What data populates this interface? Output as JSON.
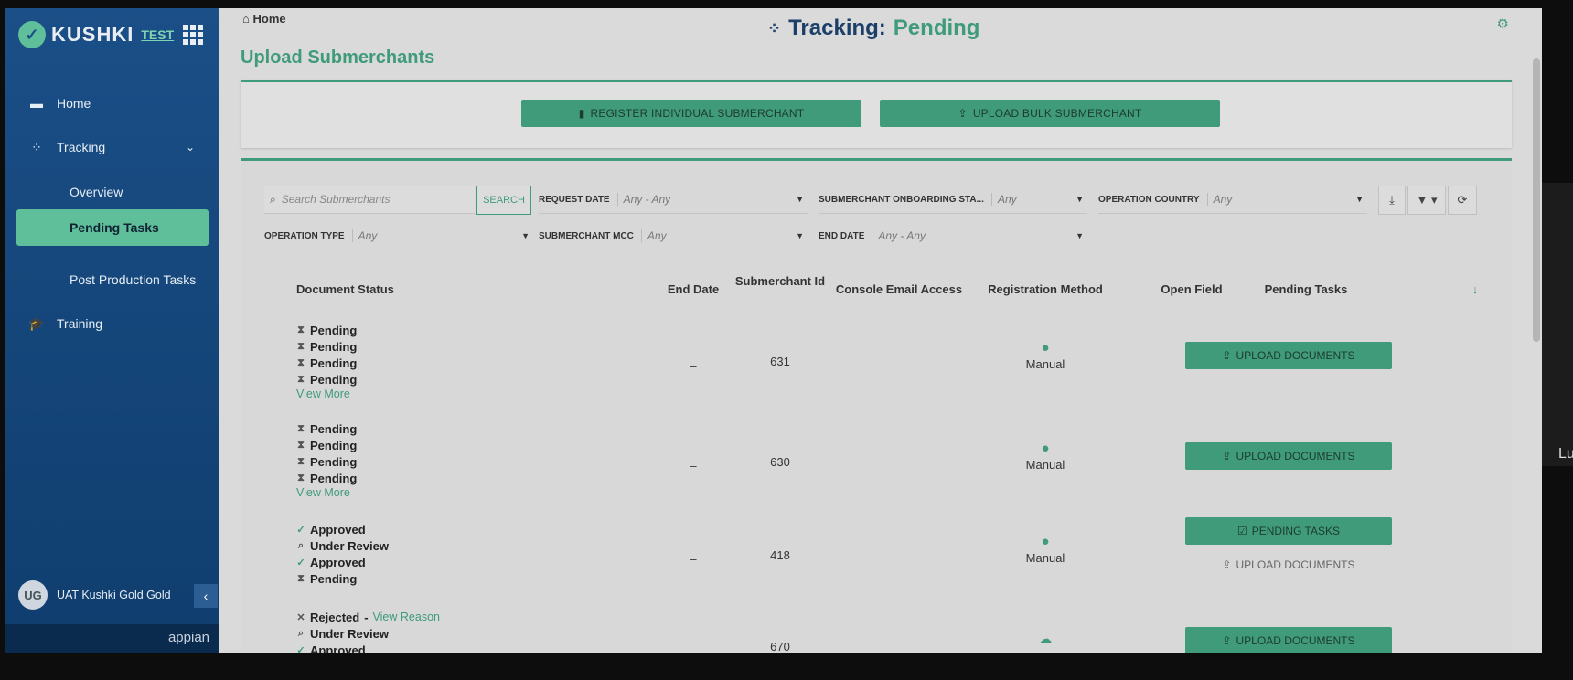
{
  "sidebar": {
    "brand": "KUSHKI",
    "env": "TEST",
    "items": [
      {
        "label": "Home",
        "icon": "home-icon"
      },
      {
        "label": "Tracking",
        "icon": "tracking-spinner-icon"
      },
      {
        "label": "Overview"
      },
      {
        "label": "Pending Tasks"
      },
      {
        "label": "Post Production Tasks"
      },
      {
        "label": "Training",
        "icon": "graduation-cap-icon"
      }
    ],
    "user_initials": "UG",
    "user_name": "UAT Kushki Gold Gold",
    "footer_brand": "appian"
  },
  "header": {
    "breadcrumb": "Home",
    "title_prefix": "Tracking:",
    "title_status": "Pending"
  },
  "page_title": "Upload Submerchants",
  "actions": {
    "register": "REGISTER INDIVIDUAL SUBMERCHANT",
    "upload_bulk": "UPLOAD BULK SUBMERCHANT"
  },
  "filters": {
    "search_placeholder": "Search Submerchants",
    "search_button": "SEARCH",
    "request_date_label": "REQUEST DATE",
    "request_date_value": "Any - Any",
    "onboarding_label": "SUBMERCHANT ONBOARDING STA...",
    "onboarding_value": "Any",
    "country_label": "OPERATION COUNTRY",
    "country_value": "Any",
    "operation_type_label": "OPERATION TYPE",
    "operation_type_value": "Any",
    "mcc_label": "SUBMERCHANT MCC",
    "mcc_value": "Any",
    "end_date_label": "END DATE",
    "end_date_value": "Any - Any"
  },
  "table": {
    "headers": {
      "document_status": "Document Status",
      "end_date": "End Date",
      "submerchant_id": "Submerchant Id",
      "console_email": "Console Email Access",
      "registration": "Registration Method",
      "open_field": "Open Field",
      "pending_tasks": "Pending Tasks"
    },
    "view_more": "View More",
    "view_reason": "View Reason",
    "rows": [
      {
        "statuses": [
          "Pending",
          "Pending",
          "Pending",
          "Pending"
        ],
        "end_date": "–",
        "id": "631",
        "method": "Manual",
        "task": "UPLOAD DOCUMENTS"
      },
      {
        "statuses": [
          "Pending",
          "Pending",
          "Pending",
          "Pending"
        ],
        "end_date": "–",
        "id": "630",
        "method": "Manual",
        "task": "UPLOAD DOCUMENTS"
      },
      {
        "statuses": [
          "Approved",
          "Under Review",
          "Approved",
          "Pending"
        ],
        "end_date": "–",
        "id": "418",
        "method": "Manual",
        "task": "PENDING TASKS",
        "task2": "UPLOAD DOCUMENTS"
      },
      {
        "statuses": [
          "Rejected",
          "Under Review",
          "Approved"
        ],
        "id": "670",
        "task": "UPLOAD DOCUMENTS"
      }
    ]
  },
  "offscreen_text": "Lu"
}
